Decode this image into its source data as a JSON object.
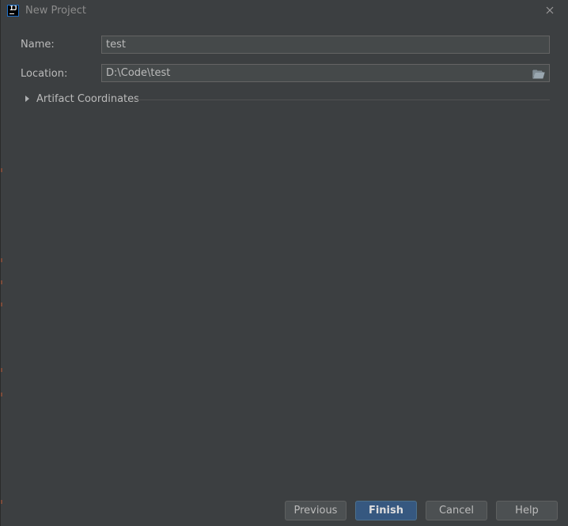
{
  "window": {
    "title": "New Project",
    "app_icon_text": "IJ",
    "close_icon": "close-icon"
  },
  "form": {
    "name_label": "Name:",
    "name_value": "test",
    "location_label": "Location:",
    "location_value": "D:\\Code\\test",
    "browse_icon": "folder-open-icon"
  },
  "section": {
    "label": "Artifact Coordinates",
    "expanded": false
  },
  "buttons": {
    "previous": "Previous",
    "finish": "Finish",
    "cancel": "Cancel",
    "help": "Help"
  },
  "colors": {
    "background": "#3c3f41",
    "field_background": "#45494a",
    "primary_button": "#365880",
    "text": "#bbbbbb"
  }
}
